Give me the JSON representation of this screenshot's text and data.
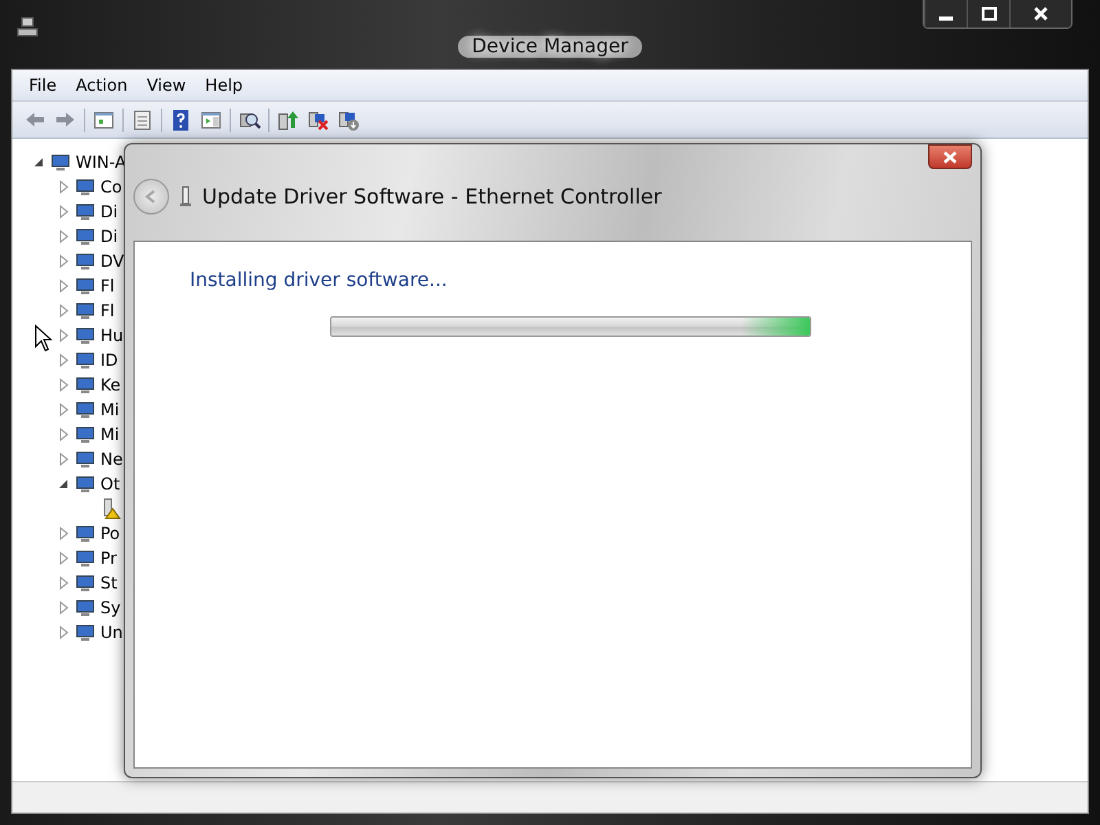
{
  "window": {
    "title": "Device Manager"
  },
  "menu": [
    "File",
    "Action",
    "View",
    "Help"
  ],
  "tree": {
    "label": "WIN-A",
    "expanded": true,
    "children": [
      {
        "label": "Co",
        "expanded": false
      },
      {
        "label": "Di",
        "expanded": false
      },
      {
        "label": "Di",
        "expanded": false
      },
      {
        "label": "DV",
        "expanded": false
      },
      {
        "label": "Fl",
        "expanded": false
      },
      {
        "label": "Fl",
        "expanded": false
      },
      {
        "label": "Hu",
        "expanded": false
      },
      {
        "label": "ID",
        "expanded": false
      },
      {
        "label": "Ke",
        "expanded": false
      },
      {
        "label": "Mi",
        "expanded": false
      },
      {
        "label": "Mi",
        "expanded": false
      },
      {
        "label": "Ne",
        "expanded": false
      },
      {
        "label": "Ot",
        "expanded": true,
        "children": [
          {
            "warning": true
          }
        ]
      },
      {
        "label": "Po",
        "expanded": false
      },
      {
        "label": "Pr",
        "expanded": false
      },
      {
        "label": "St",
        "expanded": false
      },
      {
        "label": "Sy",
        "expanded": false
      },
      {
        "label": "Un",
        "expanded": false
      }
    ]
  },
  "dialog": {
    "title": "Update Driver Software - Ethernet Controller",
    "heading": "Installing driver software...",
    "progress": {
      "level": 1
    }
  }
}
